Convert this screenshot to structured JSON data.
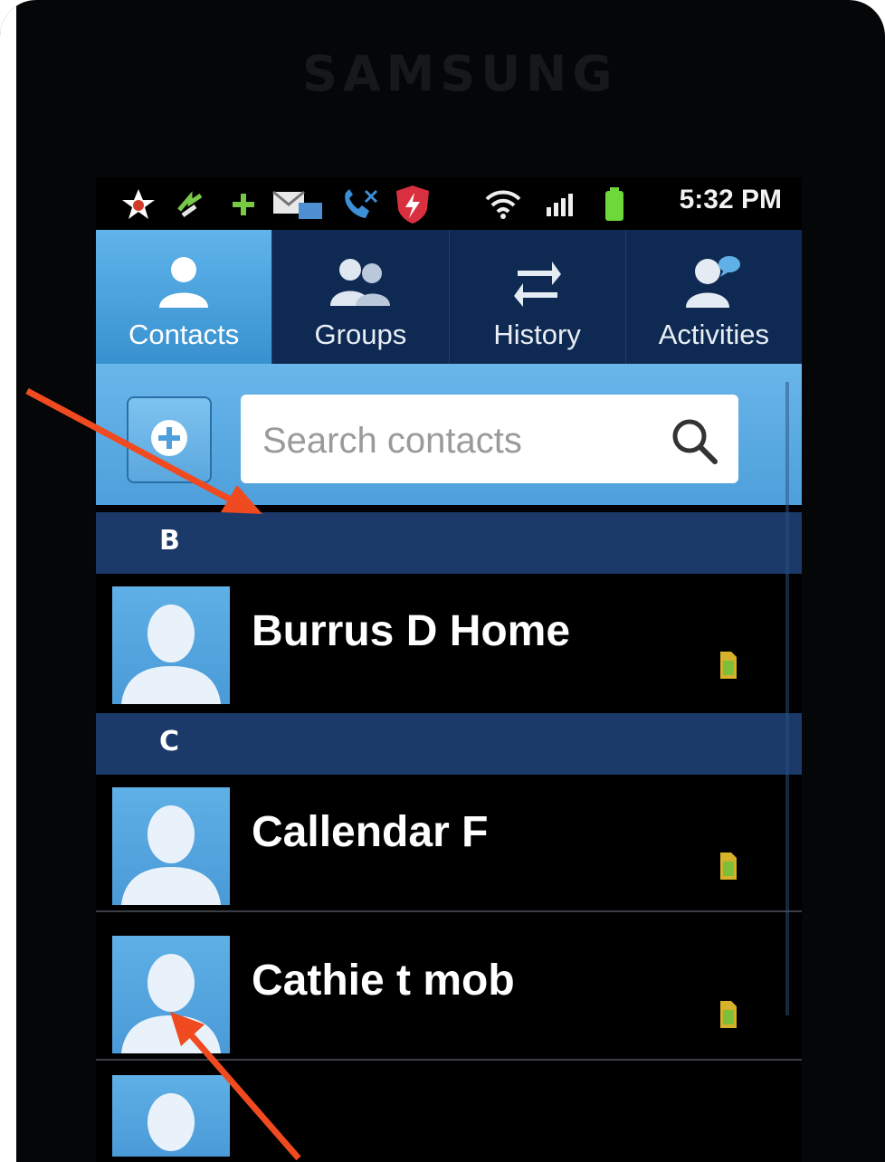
{
  "device": {
    "brand": "SAMSUNG"
  },
  "status_bar": {
    "time": "5:32 PM",
    "icons": [
      "star-icon",
      "sync-icon",
      "plus-icon",
      "message-icon",
      "missed-call-icon",
      "antivirus-shield-icon",
      "wifi-icon",
      "signal-icon",
      "battery-icon"
    ]
  },
  "tabs": [
    {
      "label": "Contacts",
      "icon": "contact-icon",
      "active": true
    },
    {
      "label": "Groups",
      "icon": "groups-icon",
      "active": false
    },
    {
      "label": "History",
      "icon": "history-icon",
      "active": false
    },
    {
      "label": "Activities",
      "icon": "activities-icon",
      "active": false
    }
  ],
  "search": {
    "placeholder": "Search contacts",
    "add_button_icon": "add-contact-icon",
    "search_icon": "search-icon"
  },
  "sections": [
    {
      "letter": "B",
      "contacts": [
        {
          "name": "Burrus D Home",
          "source_icon": "sim-card-icon"
        }
      ]
    },
    {
      "letter": "C",
      "contacts": [
        {
          "name": "Callendar F",
          "source_icon": "sim-card-icon"
        },
        {
          "name": "Cathie t mob",
          "source_icon": "sim-card-icon"
        }
      ]
    }
  ],
  "colors": {
    "accent_blue": "#4e9fdb",
    "tab_bar": "#0f2a52",
    "section_header": "#1b3a6a",
    "annotation_arrow": "#f04a20"
  }
}
